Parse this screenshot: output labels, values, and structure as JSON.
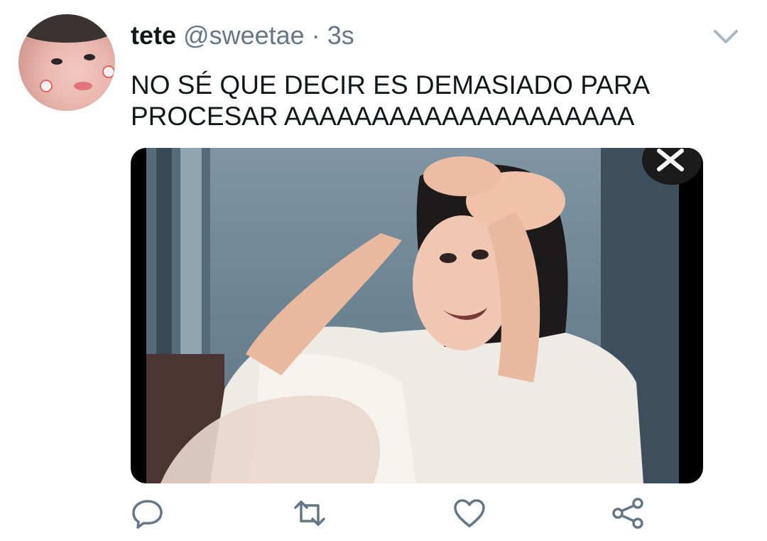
{
  "tweet": {
    "display_name": "tete",
    "handle": "@sweetae",
    "separator": "·",
    "time": "3s",
    "text_lines": [
      "NO SÉ QUE DECIR ES DEMASIADO PARA",
      "PROCESAR AAAAAAAAAAAAAAAAAAAA"
    ]
  },
  "icons": {
    "menu": "chevron-down-icon",
    "media_close": "close-icon",
    "reply": "reply-icon",
    "retweet": "retweet-icon",
    "like": "heart-icon",
    "share": "share-icon"
  },
  "colors": {
    "primary_text": "#14171a",
    "secondary_text": "#657786",
    "icon": "#657786",
    "background": "#ffffff"
  }
}
